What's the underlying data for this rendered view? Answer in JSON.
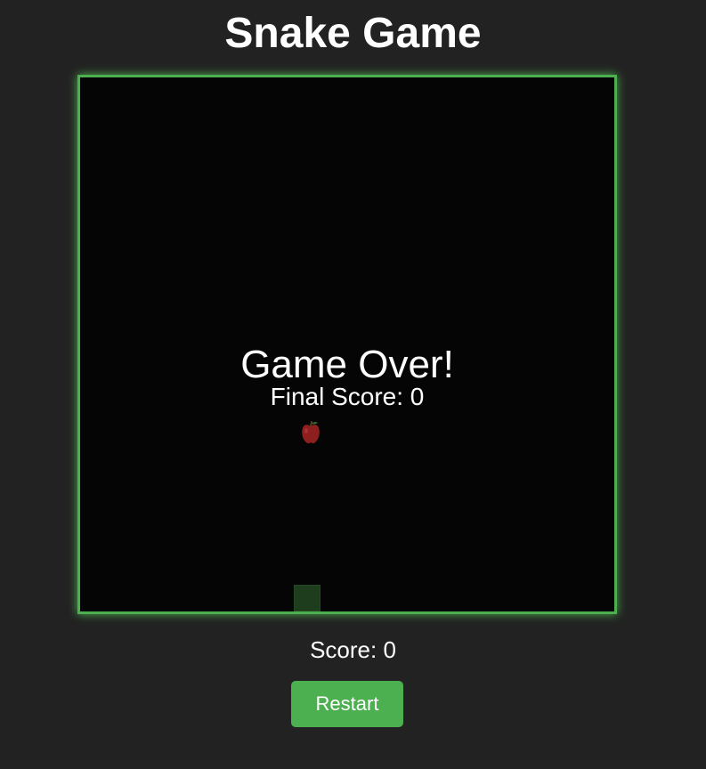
{
  "page": {
    "title": "Snake Game"
  },
  "game": {
    "state": "game-over",
    "overlay_title": "Game Over!",
    "final_score_label": "Final Score: 0",
    "final_score": 0,
    "apple_icon": "apple-icon",
    "snake_length": 1
  },
  "scoreboard": {
    "label": "Score: 0",
    "value": 0
  },
  "controls": {
    "restart_label": "Restart"
  },
  "colors": {
    "background": "#222222",
    "board": "#050505",
    "accent": "#4caf50",
    "apple": "#8e1f1f",
    "snake": "#1d3d1d"
  }
}
